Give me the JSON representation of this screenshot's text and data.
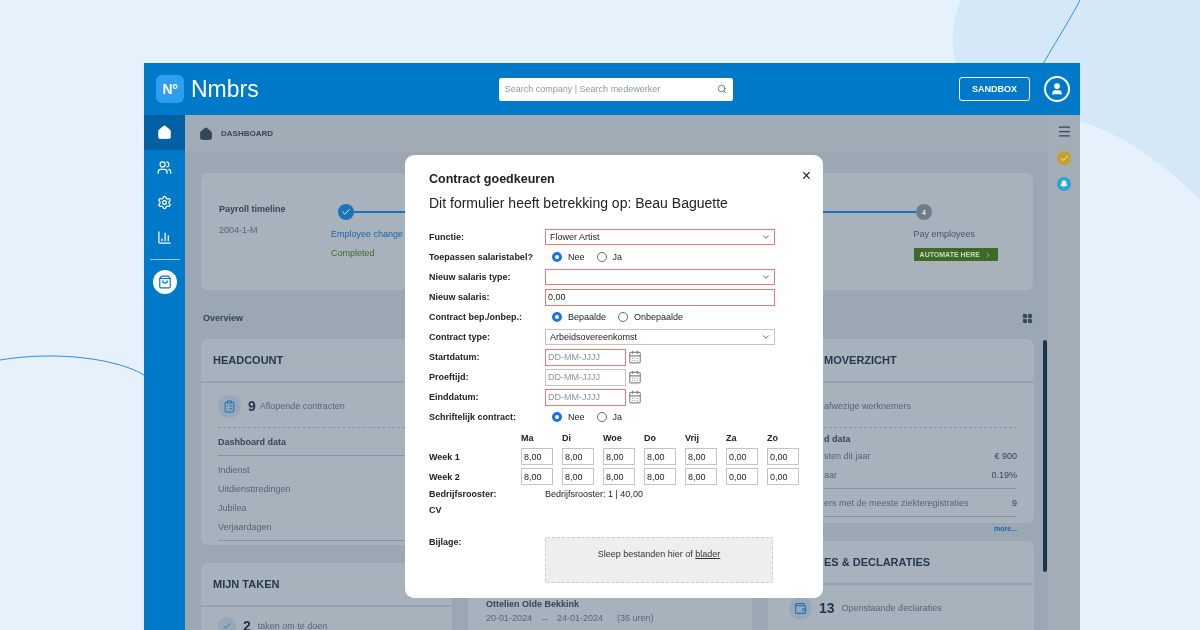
{
  "header": {
    "logo_mark": "Nº",
    "brand": "Nmbrs",
    "search_placeholder": "Search company | Search medewerker",
    "sandbox_button": "SANDBOX"
  },
  "sidebar": {
    "items": [
      {
        "kind": "home",
        "selected": true
      },
      {
        "kind": "people",
        "selected": false
      },
      {
        "kind": "settings",
        "selected": false
      },
      {
        "kind": "chart",
        "selected": false
      },
      {
        "kind": "bag",
        "selected": false
      }
    ]
  },
  "breadcrumb": "DASHBOARD",
  "timeline": {
    "title": "Payroll timeline",
    "period": "2004-1-M",
    "steps": [
      {
        "done": true,
        "label": "Employee change",
        "status": "Completed"
      },
      {
        "done": false,
        "number": "4",
        "label": "Pay employees",
        "action": "AUTOMATE HERE"
      }
    ]
  },
  "overview": "Overview",
  "headcount": {
    "title": "HEADCOUNT",
    "count": "9",
    "count_label": "Aflopende contracten",
    "section": "Dashboard data",
    "rows": [
      "Indienst",
      "Uitdiensttredingen",
      "Jubilea",
      "Verjaardagen"
    ]
  },
  "tasks": {
    "title": "MIJN TAKEN",
    "count": "2",
    "count_label": "taken om te doen"
  },
  "leave_card": {
    "name": "Ottelien Olde Bekkink",
    "from": "20-01-2024",
    "arrow": "→",
    "to": "24-01-2024",
    "hours": "(36 uren)"
  },
  "absence": {
    "title": "MOVERZICHT",
    "summary": "afwezige werknemers",
    "section": "d data",
    "rows": [
      {
        "label": "sten dit jaar",
        "value": "€ 900"
      },
      {
        "label": "aar",
        "value": "0.19%"
      },
      {
        "label": "ers met de meeste ziekteregistraties",
        "value": "9"
      }
    ],
    "more": "more..."
  },
  "declarations": {
    "title": "ES & DECLARATIES",
    "count": "13",
    "count_label": "Openstaande declaraties"
  },
  "modal": {
    "title": "Contract goedkeuren",
    "subtitle": "Dit formulier heeft betrekking op: Beau Baguette",
    "close": "×",
    "fields": [
      {
        "kind": "select",
        "label": "Functie:",
        "value": "Flower Artist",
        "error": true
      },
      {
        "kind": "radio",
        "label": "Toepassen salaristabel?",
        "options": [
          {
            "label": "Nee",
            "selected": true
          },
          {
            "label": "Ja",
            "selected": false
          }
        ]
      },
      {
        "kind": "select",
        "label": "Nieuw salaris type:",
        "error": true
      },
      {
        "kind": "text",
        "label": "Nieuw salaris:",
        "value": "0,00",
        "error": true
      },
      {
        "kind": "radio",
        "label": "Contract bep./onbep.:",
        "options": [
          {
            "label": "Bepaalde",
            "selected": true
          },
          {
            "label": "Onbepaalde",
            "selected": false
          }
        ]
      },
      {
        "kind": "select",
        "label": "Contract type:",
        "value": "Arbeidsovereenkomst",
        "error": false
      },
      {
        "kind": "date",
        "label": "Startdatum:",
        "placeholder": "DD-MM-JJJJ",
        "error": true
      },
      {
        "kind": "date",
        "label": "Proeftijd:",
        "placeholder": "DD-MM-JJJJ",
        "error": false
      },
      {
        "kind": "date",
        "label": "Einddatum:",
        "placeholder": "DD-MM-JJJJ",
        "error": true
      },
      {
        "kind": "radio",
        "label": "Schriftelijk contract:",
        "options": [
          {
            "label": "Nee",
            "selected": true
          },
          {
            "label": "Ja",
            "selected": false
          }
        ]
      }
    ],
    "days": [
      "Ma",
      "Di",
      "Woe",
      "Do",
      "Vrij",
      "Za",
      "Zo"
    ],
    "weeks": [
      {
        "label": "Week 1",
        "hours": [
          "8,00",
          "8,00",
          "8,00",
          "8,00",
          "8,00",
          "0,00",
          "0,00"
        ]
      },
      {
        "label": "Week 2",
        "hours": [
          "8,00",
          "8,00",
          "8,00",
          "8,00",
          "8,00",
          "0,00",
          "0,00"
        ]
      }
    ],
    "schedule_label": "Bedrijfsrooster:",
    "schedule_value": "Bedrijfsrooster: 1 | 40,00",
    "cv_label": "CV",
    "attachment_label": "Bijlage:",
    "drop_text": "Sleep bestanden hier of",
    "drop_link": "blader"
  }
}
